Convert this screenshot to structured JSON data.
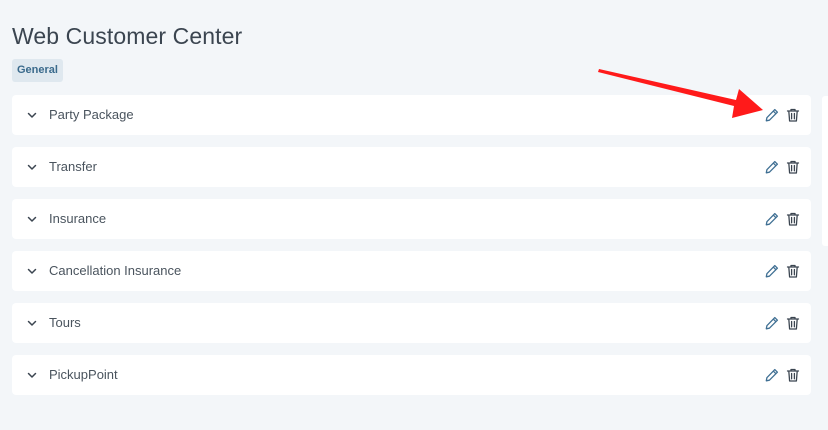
{
  "header": {
    "title": "Web Customer Center",
    "tag": "General"
  },
  "categories": [
    {
      "label": "Party Package"
    },
    {
      "label": "Transfer"
    },
    {
      "label": "Insurance"
    },
    {
      "label": "Cancellation Insurance"
    },
    {
      "label": "Tours"
    },
    {
      "label": "PickupPoint"
    }
  ],
  "icons": {
    "expand": "chevron-down-icon",
    "edit": "pencil-icon",
    "delete": "trash-icon",
    "annotation": "red-arrow-annotation"
  },
  "colors": {
    "background": "#f3f6f9",
    "row": "#ffffff",
    "tag_bg": "#dfe8ef",
    "tag_text": "#3a6a8c",
    "edit_icon": "#3f6f93",
    "delete_icon": "#3b4550",
    "arrow": "#ff1a1a"
  }
}
